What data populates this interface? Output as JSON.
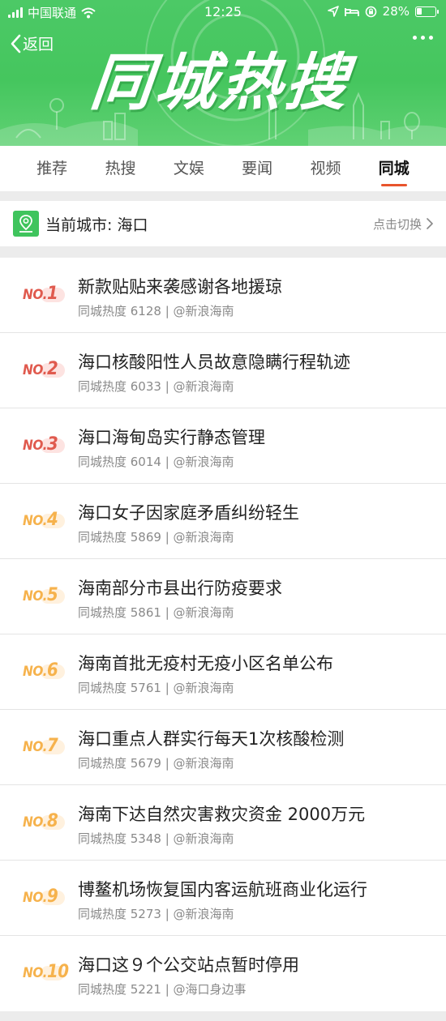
{
  "status_bar": {
    "carrier": "中国联通",
    "time": "12:25",
    "battery": "28%",
    "battery_level": 0.28
  },
  "header": {
    "back_label": "返回",
    "title": "同城热搜"
  },
  "tabs": [
    {
      "label": "推荐",
      "active": false
    },
    {
      "label": "热搜",
      "active": false
    },
    {
      "label": "文娱",
      "active": false
    },
    {
      "label": "要闻",
      "active": false
    },
    {
      "label": "视频",
      "active": false
    },
    {
      "label": "同城",
      "active": true
    }
  ],
  "city": {
    "label": "当前城市: 海口",
    "switch_label": "点击切换"
  },
  "items": [
    {
      "rank": "1",
      "title": "新款贴贴来袭感谢各地援琼",
      "heat": "同城热度 6128",
      "source": "@新浪海南"
    },
    {
      "rank": "2",
      "title": "海口核酸阳性人员故意隐瞒行程轨迹",
      "heat": "同城热度 6033",
      "source": "@新浪海南"
    },
    {
      "rank": "3",
      "title": "海口海甸岛实行静态管理",
      "heat": "同城热度 6014",
      "source": "@新浪海南"
    },
    {
      "rank": "4",
      "title": "海口女子因家庭矛盾纠纷轻生",
      "heat": "同城热度 5869",
      "source": "@新浪海南"
    },
    {
      "rank": "5",
      "title": "海南部分市县出行防疫要求",
      "heat": "同城热度 5861",
      "source": "@新浪海南"
    },
    {
      "rank": "6",
      "title": "海南首批无疫村无疫小区名单公布",
      "heat": "同城热度 5761",
      "source": "@新浪海南"
    },
    {
      "rank": "7",
      "title": "海口重点人群实行每天1次核酸检测",
      "heat": "同城热度 5679",
      "source": "@新浪海南"
    },
    {
      "rank": "8",
      "title": "海南下达自然灾害救灾资金 2000万元",
      "heat": "同城热度 5348",
      "source": "@新浪海南"
    },
    {
      "rank": "9",
      "title": "博鳌机场恢复国内客运航班商业化运行",
      "heat": "同城热度 5273",
      "source": "@新浪海南"
    },
    {
      "rank": "10",
      "title": "海口这９个公交站点暂时停用",
      "heat": "同城热度 5221",
      "source": "@海口身边事"
    }
  ],
  "colors": {
    "header_green": "#45c65e",
    "tab_indicator": "#e8542c",
    "rank_top": "#e05a4e",
    "rank_normal": "#f6b24c"
  }
}
